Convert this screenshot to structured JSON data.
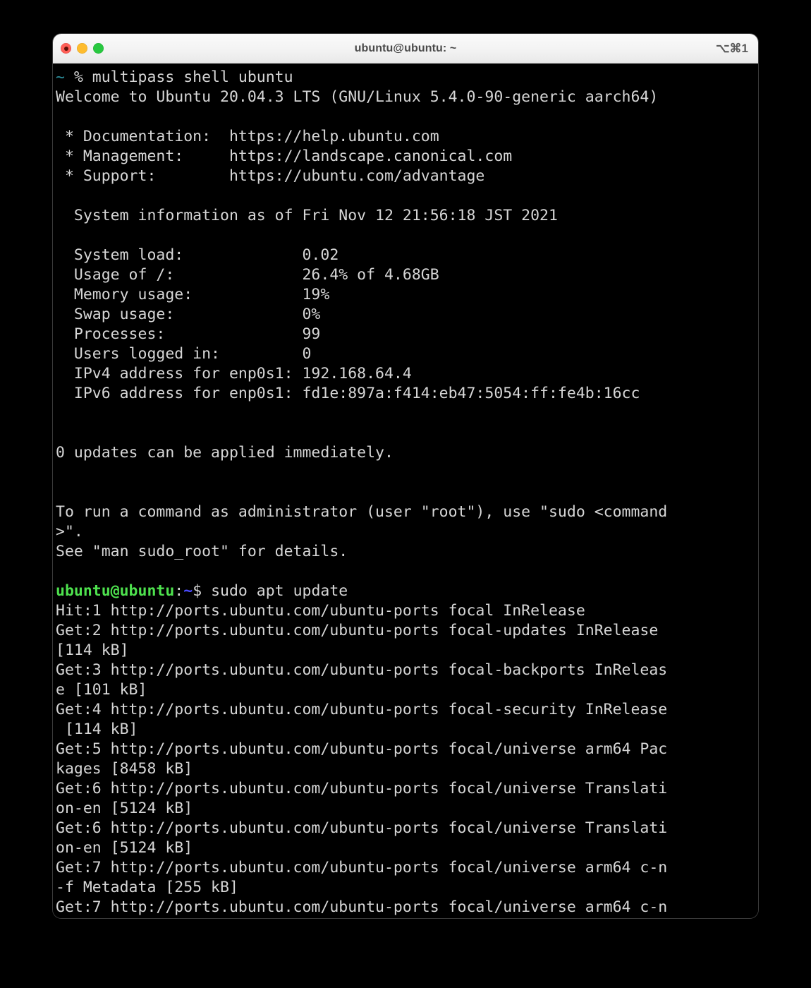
{
  "window": {
    "title": "ubuntu@ubuntu: ~",
    "shortcut": "⌥⌘1",
    "controls": {
      "close": "close",
      "minimize": "minimize",
      "maximize": "maximize"
    }
  },
  "colors": {
    "background": "#000000",
    "foreground": "#cfcfcf",
    "prompt_user": "#4ee24e",
    "prompt_path": "#4a4aff",
    "host_tilde": "#2d8f9c",
    "titlebar": "#f3f3f3",
    "close": "#ff5f57",
    "minimize": "#febc2e",
    "maximize": "#28c840"
  },
  "terminal": {
    "lines": [
      [
        {
          "t": "~",
          "c": "teal"
        },
        {
          "t": " % multipass shell ubuntu",
          "c": "white"
        }
      ],
      [
        {
          "t": "Welcome to Ubuntu 20.04.3 LTS (GNU/Linux 5.4.0-90-generic aarch64)",
          "c": "white"
        }
      ],
      [
        {
          "t": "",
          "c": "white"
        }
      ],
      [
        {
          "t": " * Documentation:  https://help.ubuntu.com",
          "c": "white"
        }
      ],
      [
        {
          "t": " * Management:     https://landscape.canonical.com",
          "c": "white"
        }
      ],
      [
        {
          "t": " * Support:        https://ubuntu.com/advantage",
          "c": "white"
        }
      ],
      [
        {
          "t": "",
          "c": "white"
        }
      ],
      [
        {
          "t": "  System information as of Fri Nov 12 21:56:18 JST 2021",
          "c": "white"
        }
      ],
      [
        {
          "t": "",
          "c": "white"
        }
      ],
      [
        {
          "t": "  System load:             0.02",
          "c": "white"
        }
      ],
      [
        {
          "t": "  Usage of /:              26.4% of 4.68GB",
          "c": "white"
        }
      ],
      [
        {
          "t": "  Memory usage:            19%",
          "c": "white"
        }
      ],
      [
        {
          "t": "  Swap usage:              0%",
          "c": "white"
        }
      ],
      [
        {
          "t": "  Processes:               99",
          "c": "white"
        }
      ],
      [
        {
          "t": "  Users logged in:         0",
          "c": "white"
        }
      ],
      [
        {
          "t": "  IPv4 address for enp0s1: 192.168.64.4",
          "c": "white"
        }
      ],
      [
        {
          "t": "  IPv6 address for enp0s1: fd1e:897a:f414:eb47:5054:ff:fe4b:16cc",
          "c": "white"
        }
      ],
      [
        {
          "t": "",
          "c": "white"
        }
      ],
      [
        {
          "t": "",
          "c": "white"
        }
      ],
      [
        {
          "t": "0 updates can be applied immediately.",
          "c": "white"
        }
      ],
      [
        {
          "t": "",
          "c": "white"
        }
      ],
      [
        {
          "t": "",
          "c": "white"
        }
      ],
      [
        {
          "t": "To run a command as administrator (user \"root\"), use \"sudo <command",
          "c": "white"
        }
      ],
      [
        {
          "t": ">\".",
          "c": "white"
        }
      ],
      [
        {
          "t": "See \"man sudo_root\" for details.",
          "c": "white"
        }
      ],
      [
        {
          "t": "",
          "c": "white"
        }
      ],
      [
        {
          "t": "ubuntu@ubuntu",
          "c": "green"
        },
        {
          "t": ":",
          "c": "white"
        },
        {
          "t": "~",
          "c": "blue"
        },
        {
          "t": "$ sudo apt update",
          "c": "white"
        }
      ],
      [
        {
          "t": "Hit:1 http://ports.ubuntu.com/ubuntu-ports focal InRelease",
          "c": "white"
        }
      ],
      [
        {
          "t": "Get:2 http://ports.ubuntu.com/ubuntu-ports focal-updates InRelease",
          "c": "white"
        }
      ],
      [
        {
          "t": "[114 kB]",
          "c": "white"
        }
      ],
      [
        {
          "t": "Get:3 http://ports.ubuntu.com/ubuntu-ports focal-backports InReleas",
          "c": "white"
        }
      ],
      [
        {
          "t": "e [101 kB]",
          "c": "white"
        }
      ],
      [
        {
          "t": "Get:4 http://ports.ubuntu.com/ubuntu-ports focal-security InRelease",
          "c": "white"
        }
      ],
      [
        {
          "t": " [114 kB]",
          "c": "white"
        }
      ],
      [
        {
          "t": "Get:5 http://ports.ubuntu.com/ubuntu-ports focal/universe arm64 Pac",
          "c": "white"
        }
      ],
      [
        {
          "t": "kages [8458 kB]",
          "c": "white"
        }
      ],
      [
        {
          "t": "Get:6 http://ports.ubuntu.com/ubuntu-ports focal/universe Translati",
          "c": "white"
        }
      ],
      [
        {
          "t": "on-en [5124 kB]",
          "c": "white"
        }
      ],
      [
        {
          "t": "Get:6 http://ports.ubuntu.com/ubuntu-ports focal/universe Translati",
          "c": "white"
        }
      ],
      [
        {
          "t": "on-en [5124 kB]",
          "c": "white"
        }
      ],
      [
        {
          "t": "Get:7 http://ports.ubuntu.com/ubuntu-ports focal/universe arm64 c-n",
          "c": "white"
        }
      ],
      [
        {
          "t": "-f Metadata [255 kB]",
          "c": "white"
        }
      ],
      [
        {
          "t": "Get:7 http://ports.ubuntu.com/ubuntu-ports focal/universe arm64 c-n",
          "c": "white"
        }
      ]
    ]
  }
}
